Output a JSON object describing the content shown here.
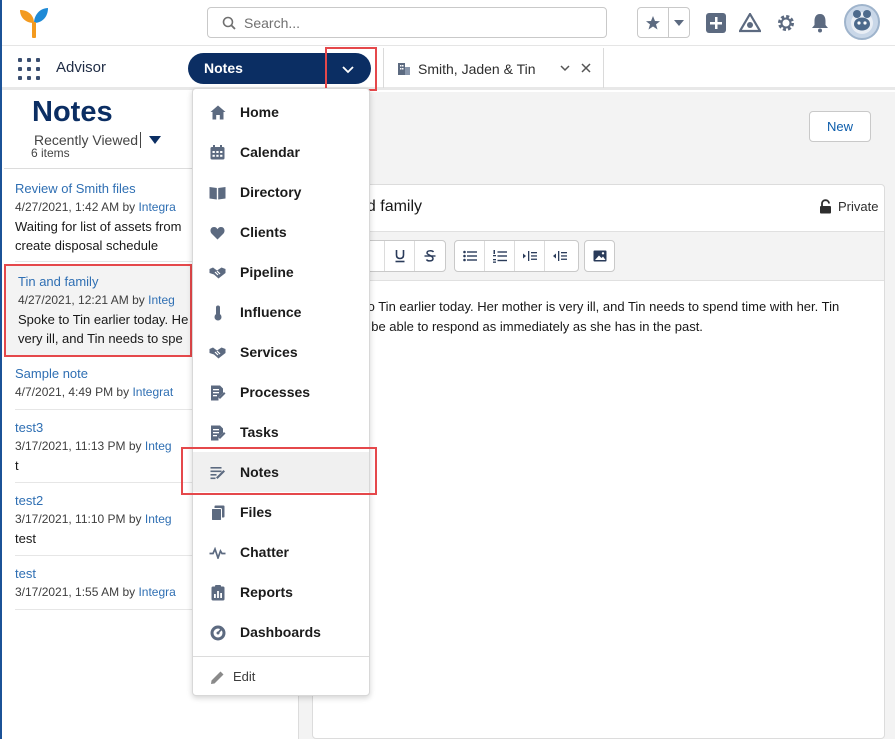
{
  "header": {
    "search_placeholder": "Search..."
  },
  "nav": {
    "app_name": "Advisor",
    "current_item": "Notes",
    "record_tab": "Smith, Jaden & Tin"
  },
  "list": {
    "title": "Notes",
    "view_name": "Recently Viewed",
    "count": "6 items",
    "items": [
      {
        "title": "Review of Smith files",
        "date": "4/27/2021, 1:42 AM",
        "by": "by",
        "owner": "Integra",
        "body1": "Waiting for list of assets from",
        "body2": "create disposal schedule"
      },
      {
        "title": "Tin and family",
        "date": "4/27/2021, 12:21 AM",
        "by": "by",
        "owner": "Integ",
        "body1": "Spoke to Tin earlier today. He",
        "body2": "very ill, and Tin needs to spe"
      },
      {
        "title": "Sample note",
        "date": "4/7/2021, 4:49 PM",
        "by": "by",
        "owner": "Integrat",
        "body1": "",
        "body2": ""
      },
      {
        "title": "test3",
        "date": "3/17/2021, 11:13 PM",
        "by": "by",
        "owner": "Integ",
        "body1": "t",
        "body2": ""
      },
      {
        "title": "test2",
        "date": "3/17/2021, 11:10 PM",
        "by": "by",
        "owner": "Integ",
        "body1": "test",
        "body2": ""
      },
      {
        "title": "test",
        "date": "3/17/2021, 1:55 AM",
        "by": "by",
        "owner": "Integra",
        "body1": "",
        "body2": ""
      }
    ]
  },
  "detail": {
    "new_button": "New",
    "title": "nd family",
    "privacy": "Private",
    "body_line1": "to Tin earlier today. Her mother is very ill, and Tin needs to spend time with her. Tin",
    "body_line2": "t be able to respond as immediately as she has in the past."
  },
  "menu": {
    "items": [
      {
        "label": "Home",
        "icon": "home-icon"
      },
      {
        "label": "Calendar",
        "icon": "calendar-icon"
      },
      {
        "label": "Directory",
        "icon": "directory-icon"
      },
      {
        "label": "Clients",
        "icon": "heart-icon"
      },
      {
        "label": "Pipeline",
        "icon": "handshake-icon"
      },
      {
        "label": "Influence",
        "icon": "thermometer-icon"
      },
      {
        "label": "Services",
        "icon": "handshake-icon"
      },
      {
        "label": "Processes",
        "icon": "process-icon"
      },
      {
        "label": "Tasks",
        "icon": "task-icon"
      },
      {
        "label": "Notes",
        "icon": "note-icon"
      },
      {
        "label": "Files",
        "icon": "files-icon"
      },
      {
        "label": "Chatter",
        "icon": "pulse-icon"
      },
      {
        "label": "Reports",
        "icon": "report-icon"
      },
      {
        "label": "Dashboards",
        "icon": "gauge-icon"
      }
    ],
    "edit_label": "Edit"
  },
  "colors": {
    "brand_navy": "#0b2e63",
    "link_blue": "#2f6fb3",
    "highlight_red": "#e5484b",
    "logo_orange": "#f39a1f",
    "logo_blue": "#1f8ad6"
  }
}
